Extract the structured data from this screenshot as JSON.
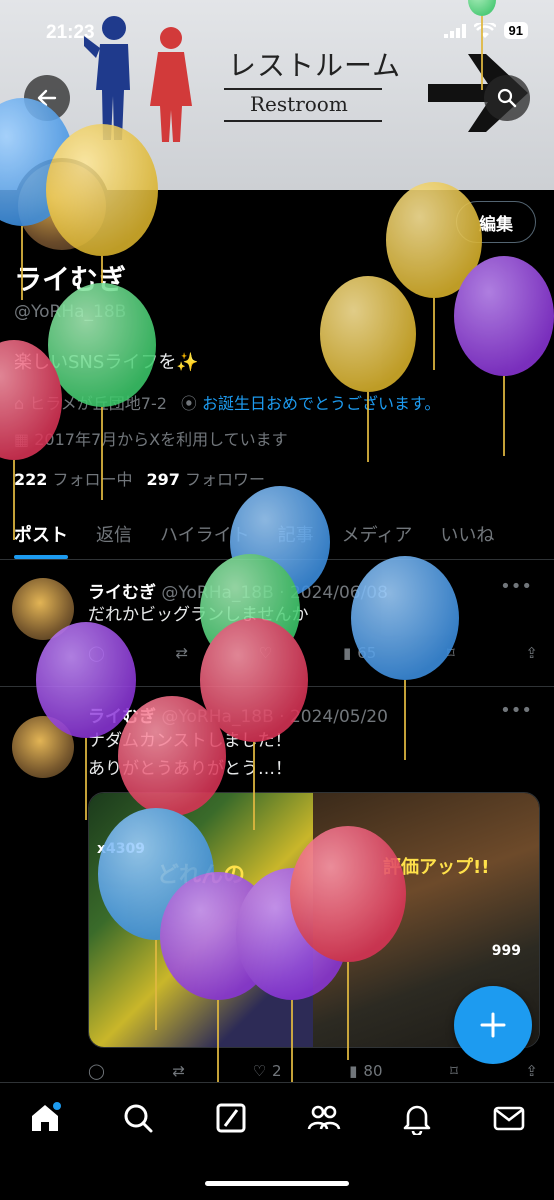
{
  "status_bar": {
    "time": "21:23",
    "battery": "91"
  },
  "banner": {
    "sign_japanese": "レストルーム",
    "sign_english": "Restroom"
  },
  "profile": {
    "edit_label": "編集",
    "name": "ライむぎ",
    "handle": "@YoRHa_18B",
    "bio": "楽しいSNSライフを✨",
    "location": "ヒラメが丘団地7-2",
    "birthday_link": "お誕生日おめでとうございます。",
    "joined": "2017年7月からXを利用しています",
    "following_count": "222",
    "following_label": "フォロー中",
    "followers_count": "297",
    "followers_label": "フォロワー"
  },
  "tabs": [
    "ポスト",
    "返信",
    "ハイライト",
    "記事",
    "メディア",
    "いいね"
  ],
  "posts": [
    {
      "name": "ライむぎ",
      "meta": "@YoRHa_18B · 2024/06/08",
      "text_lines": [
        "だれかビッグランしませんか"
      ],
      "views": "65"
    },
    {
      "name": "ライむぎ",
      "meta": "@YoRHa_18B · 2024/05/20",
      "text_lines": [
        "ナダムカンストしました！",
        "ありがとうありがとう…！"
      ],
      "media_text_left": "x4309",
      "media_text_left2": "どれんの",
      "media_text_right": "評価アップ!!",
      "media_score": "999",
      "likes": "2",
      "views": "80"
    }
  ],
  "icons": {
    "back": "back-arrow-icon",
    "search": "search-icon",
    "fab": "compose-plus-icon",
    "nav": [
      "home-icon",
      "search-icon",
      "grok-icon",
      "communities-icon",
      "notifications-icon",
      "messages-icon"
    ]
  },
  "colors": {
    "accent": "#1d9bf0",
    "background": "#000000",
    "muted": "#71767b"
  }
}
